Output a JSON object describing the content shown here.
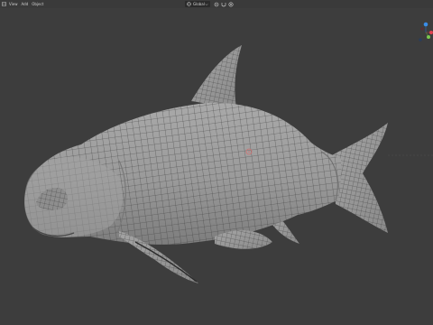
{
  "header": {
    "menu": [
      "View",
      "Add",
      "Object"
    ],
    "orientation": {
      "label": "Global",
      "icon": "transform-orientation-icon"
    },
    "tools": [
      "pivot-icon",
      "snap-icon",
      "proportional-edit-icon"
    ]
  },
  "viewport": {
    "background": "#3d3d3d",
    "gizmo": {
      "axes": [
        {
          "name": "x-axis-icon",
          "color": "#e0414f"
        },
        {
          "name": "y-axis-icon",
          "color": "#7ac94f"
        },
        {
          "name": "z-axis-icon",
          "color": "#3a8de8"
        }
      ]
    },
    "model": "fish-mesh",
    "mesh_color": "#9a9a9a",
    "wire_color": "#3a3a3a"
  }
}
